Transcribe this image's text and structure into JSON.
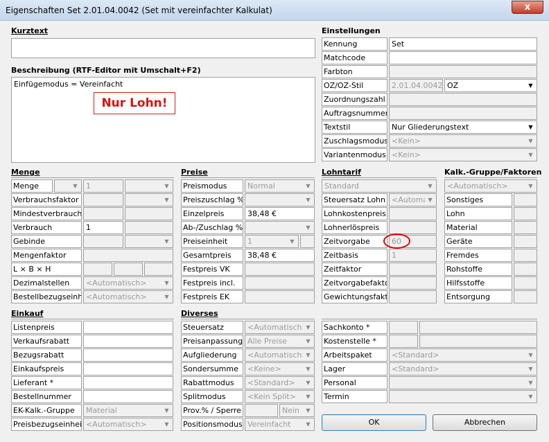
{
  "window": {
    "title": "Eigenschaften Set 2.01.04.0042 (Set mit vereinfachter Kalkulat)",
    "close": "x"
  },
  "kurztext": {
    "header": "Kurztext",
    "value": ""
  },
  "beschreibung": {
    "header": "Beschreibung (RTF-Editor mit Umschalt+F2)",
    "text": "Einfügemodus = Vereinfacht",
    "stamp": "Nur Lohn!"
  },
  "einstellungen": {
    "header": "Einstellungen",
    "kennung": {
      "label": "Kennung",
      "value": "Set"
    },
    "matchcode": {
      "label": "Matchcode",
      "value": ""
    },
    "farbton": {
      "label": "Farbton",
      "value": ""
    },
    "ozstil": {
      "label": "OZ/OZ-Stil",
      "value": "2.01.04.0042",
      "select": "OZ"
    },
    "zuordnungszahl": {
      "label": "Zuordnungszahl",
      "value": ""
    },
    "auftragsnummer": {
      "label": "Auftragsnummer",
      "value": ""
    },
    "textstil": {
      "label": "Textstil",
      "value": "Nur Gliederungstext"
    },
    "zuschlagsmodus": {
      "label": "Zuschlagsmodus",
      "value": "<Kein>"
    },
    "variantenmodus": {
      "label": "Variantenmodus",
      "value": "<Kein>"
    }
  },
  "menge": {
    "header": "Menge",
    "rows": [
      {
        "label": "Menge",
        "value": "1"
      },
      {
        "label": "Verbrauchsfaktor",
        "value": ""
      },
      {
        "label": "Mindestverbrauch",
        "value": ""
      },
      {
        "label": "Verbrauch",
        "value": "1"
      },
      {
        "label": "Gebinde",
        "value": ""
      },
      {
        "label": "Mengenfaktor",
        "value": ""
      },
      {
        "label": "L × B × H",
        "value": ""
      },
      {
        "label": "Dezimalstellen",
        "value": "<Automatisch>"
      },
      {
        "label": "Bestellbezugseinheit",
        "value": "<Automatisch>"
      }
    ]
  },
  "preise": {
    "header": "Preise",
    "rows": [
      {
        "label": "Preismodus",
        "value": "Normal"
      },
      {
        "label": "Preiszuschlag %",
        "value": ""
      },
      {
        "label": "Einzelpreis",
        "value": "38,48 €"
      },
      {
        "label": "Ab-/Zuschlag %",
        "value": ""
      },
      {
        "label": "Preiseinheit",
        "value": "1"
      },
      {
        "label": "Gesamtpreis",
        "value": "38,48 €"
      },
      {
        "label": "Festpreis VK",
        "value": ""
      },
      {
        "label": "Festpreis incl.",
        "value": ""
      },
      {
        "label": "Festpreis EK",
        "value": ""
      }
    ]
  },
  "lohntarif": {
    "header": "Lohntarif",
    "top": "Standard",
    "rows": [
      {
        "label": "Steuersatz Lohn",
        "value": "<Automat"
      },
      {
        "label": "Lohnkostenpreis",
        "value": ""
      },
      {
        "label": "Lohnerlöspreis",
        "value": ""
      },
      {
        "label": "Zeitvorgabe",
        "value": "60"
      },
      {
        "label": "Zeitbasis",
        "value": "1"
      },
      {
        "label": "Zeitfaktor",
        "value": ""
      },
      {
        "label": "Zeitvorgabefaktor",
        "value": ""
      },
      {
        "label": "Gewichtungsfaktor",
        "value": ""
      }
    ]
  },
  "kalk": {
    "header": "Kalk.-Gruppe/Faktoren",
    "top": "<Automatisch>",
    "rows": [
      "Sonstiges",
      "Lohn",
      "Material",
      "Geräte",
      "Fremdes",
      "Rohstoffe",
      "Hilfsstoffe",
      "Entsorgung"
    ]
  },
  "einkauf": {
    "header": "Einkauf",
    "rows": [
      {
        "label": "Listenpreis",
        "value": ""
      },
      {
        "label": "Verkaufsrabatt",
        "value": ""
      },
      {
        "label": "Bezugsrabatt",
        "value": ""
      },
      {
        "label": "Einkaufspreis",
        "value": ""
      },
      {
        "label": "Lieferant *",
        "value": ""
      },
      {
        "label": "Bestellnummer",
        "value": ""
      },
      {
        "label": "EK-Kalk.-Gruppe",
        "value": "Material"
      },
      {
        "label": "Preisbezugseinheit",
        "value": "<Automatisch>"
      }
    ]
  },
  "diverses": {
    "header": "Diverses",
    "rows": [
      {
        "label": "Steuersatz",
        "value": "<Automatisch>"
      },
      {
        "label": "Preisanpassung",
        "value": "Alle Preise"
      },
      {
        "label": "Aufgliederung",
        "value": "<Automatisch>"
      },
      {
        "label": "Sondersumme",
        "value": "<Keine>"
      },
      {
        "label": "Rabattmodus",
        "value": "<Standard>"
      },
      {
        "label": "Splitmodus",
        "value": "<Kein Split>"
      },
      {
        "label": "Prov.% / Sperre",
        "value": "Nein"
      },
      {
        "label": "Positionsmodus",
        "value": "Vereinfacht"
      }
    ]
  },
  "konten": {
    "rows": [
      {
        "label": "Sachkonto *",
        "value": ""
      },
      {
        "label": "Kostenstelle *",
        "value": ""
      },
      {
        "label": "Arbeitspaket",
        "value": "<Standard>"
      },
      {
        "label": "Lager",
        "value": "<Standard>"
      },
      {
        "label": "Personal",
        "value": ""
      },
      {
        "label": "Termin",
        "value": ""
      }
    ]
  },
  "buttons": {
    "ok": "OK",
    "cancel": "Abbrechen"
  }
}
